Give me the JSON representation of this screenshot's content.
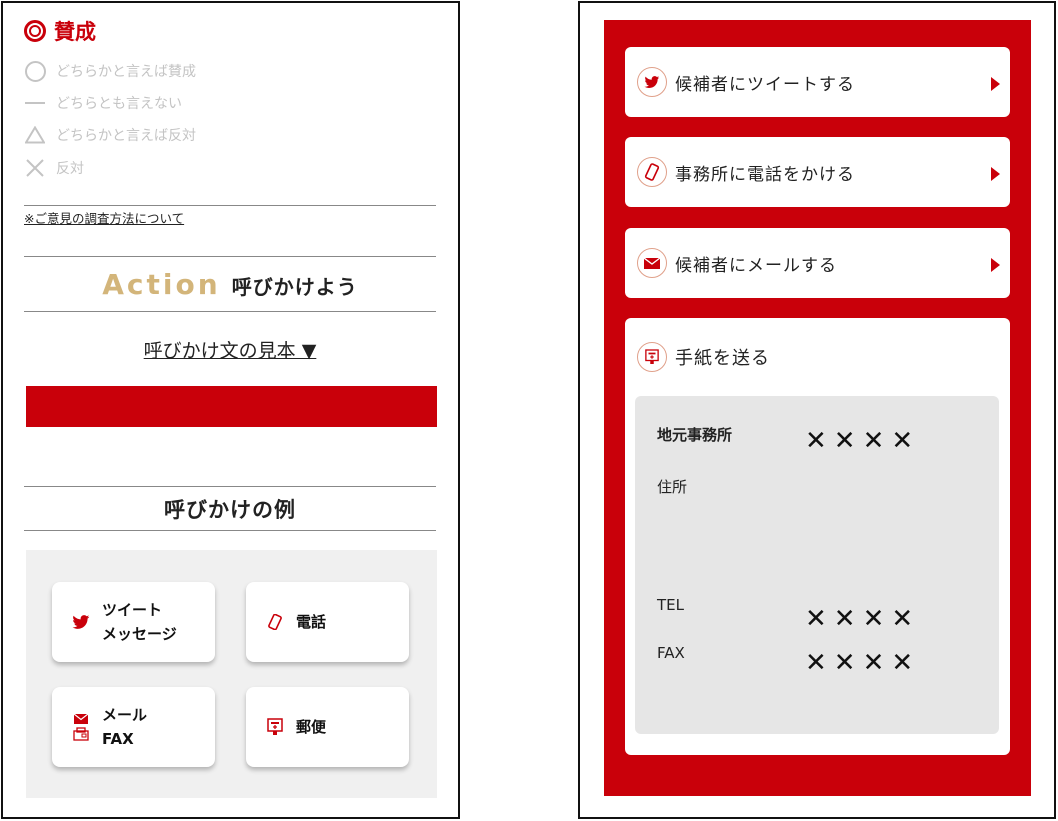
{
  "left": {
    "vote_selected": "賛成",
    "vote_options": [
      "どちらかと言えば賛成",
      "どちらとも言えない",
      "どちらかと言えば反対",
      "反対"
    ],
    "survey_link": "※ご意見の調査方法について",
    "action_word": "Action",
    "action_sub": "呼びかけよう",
    "sample_link": "呼びかけ文の見本 ▼",
    "examples_heading": "呼びかけの例",
    "examples": [
      {
        "icon": "twitter-icon",
        "line1": "ツイート",
        "line2": "メッセージ"
      },
      {
        "icon": "phone-icon",
        "line1": "電話",
        "line2": ""
      },
      {
        "icon": "mail-fax-icon",
        "line1": "メール",
        "line2": "FAX"
      },
      {
        "icon": "postbox-icon",
        "line1": "郵便",
        "line2": ""
      }
    ]
  },
  "right": {
    "actions": [
      {
        "icon": "twitter-icon",
        "label": "候補者にツイートする"
      },
      {
        "icon": "phone-icon",
        "label": "事務所に電話をかける"
      },
      {
        "icon": "mail-icon",
        "label": "候補者にメールする"
      }
    ],
    "letter_label": "手紙を送る",
    "office_label": "地元事務所",
    "address_label": "住所",
    "tel_label": "TEL",
    "fax_label": "FAX",
    "office_value": "✕✕✕✕",
    "tel_value": "✕✕✕✕",
    "fax_value": "✕✕✕✕"
  },
  "colors": {
    "accent": "#c9000a",
    "gold": "#d3b57a",
    "muted": "#c4c4c4"
  }
}
